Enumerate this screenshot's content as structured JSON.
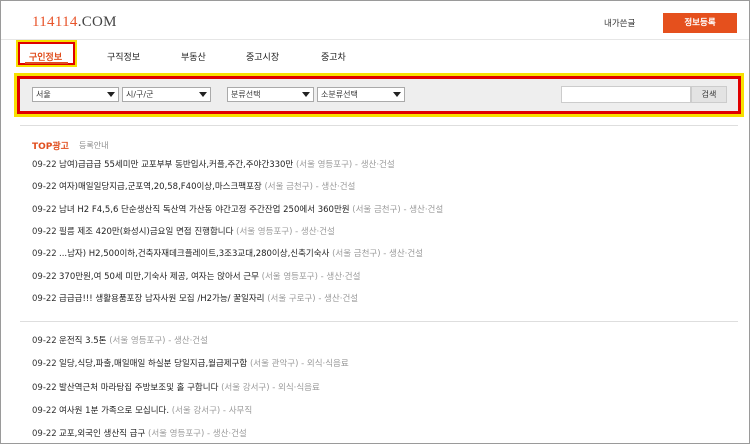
{
  "header": {
    "logo_num": "114114",
    "logo_domain": ".COM",
    "my_page": "내가쓴글",
    "post_button": "정보등록"
  },
  "nav": {
    "tabs": [
      {
        "label": "구인정보",
        "active": true
      },
      {
        "label": "구직정보",
        "active": false
      },
      {
        "label": "부동산",
        "active": false
      },
      {
        "label": "중고시장",
        "active": false
      },
      {
        "label": "중고차",
        "active": false
      }
    ]
  },
  "filter": {
    "region": "서울",
    "district": "시/구/군",
    "category": "분류선택",
    "subcategory": "소분류선택",
    "search_label": "검색",
    "search_value": ""
  },
  "top_ads": {
    "title": "TOP광고",
    "guide": "등록안내",
    "items": [
      {
        "date": "09-22",
        "title": "남여)급급급 55세미만 교포부부 동반입사,커플,주간,주야간330만",
        "loc": "(서울 영등포구)",
        "cat": "생산·건설"
      },
      {
        "date": "09-22",
        "title": "여자)매일일당지급,군포역,20,58,F40이상,마스크팩포장",
        "loc": "(서울 금천구)",
        "cat": "생산·건설"
      },
      {
        "date": "09-22",
        "title": "남녀 H2 F4,5,6 단순생산직 독산역 가산동 야간고정 주간잔업 250에서 360만원",
        "loc": "(서울 금천구)",
        "cat": "생산·건설"
      },
      {
        "date": "09-22",
        "title": "필름 제조 420만(화성시)금요일 면접 진행합니다",
        "loc": "(서울 영등포구)",
        "cat": "생산·건설"
      },
      {
        "date": "09-22",
        "title": "...남자) H2,500이하,건축자재데크플레이트,3조3교대,280이상,신축기숙사",
        "loc": "(서울 금천구)",
        "cat": "생산·건설"
      },
      {
        "date": "09-22",
        "title": "370만원,여 50세 미만,기숙사 제공, 여자는 앉아서 근무",
        "loc": "(서울 영등포구)",
        "cat": "생산·건설"
      },
      {
        "date": "09-22",
        "title": "급급급!!! 생활용품포장 남자사원 모집 /H2가능/ 꿀일자리",
        "loc": "(서울 구로구)",
        "cat": "생산·건설"
      }
    ]
  },
  "listings": {
    "items": [
      {
        "date": "09-22",
        "title": "운전직 3.5톤",
        "loc": "(서울 영등포구)",
        "cat": "생산·건설"
      },
      {
        "date": "09-22",
        "title": "일당,식당,파출,매일매일 하실분 당일지급,월급제구함",
        "loc": "(서울 관악구)",
        "cat": "외식·식음료"
      },
      {
        "date": "09-22",
        "title": "발산역근처 마라탕집 주방보조및 홀 구합니다",
        "loc": "(서울 강서구)",
        "cat": "외식·식음료"
      },
      {
        "date": "09-22",
        "title": "여사원 1분 가족으로 모십니다.",
        "loc": "(서울 강서구)",
        "cat": "사무직"
      },
      {
        "date": "09-22",
        "title": "교포,외국인 생산직 급구",
        "loc": "(서울 영등포구)",
        "cat": "생산·건설"
      }
    ]
  },
  "separator": "-",
  "colors": {
    "accent": "#e04e1e",
    "highlight_outer": "#f7e000",
    "highlight_inner": "#e00000"
  }
}
